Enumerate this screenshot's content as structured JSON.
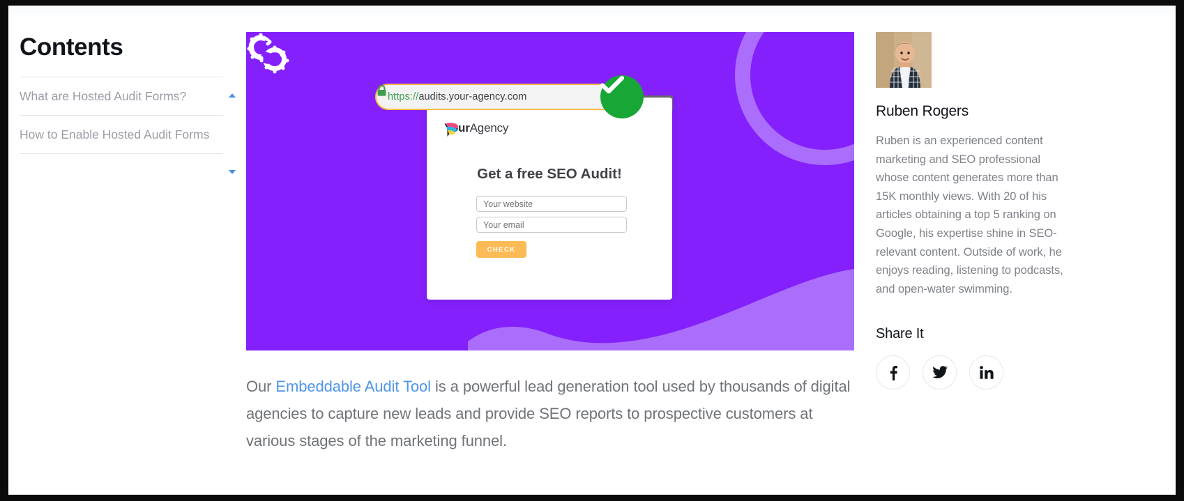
{
  "contents": {
    "title": "Contents",
    "items": [
      {
        "label": "What are Hosted Audit Forms?"
      },
      {
        "label": "How to Enable Hosted Audit Forms"
      }
    ],
    "scroll_up_icon": "caret-up-icon",
    "scroll_down_icon": "caret-down-icon"
  },
  "hero": {
    "background_color": "#8420fb",
    "accent_color": "#ab6efc",
    "browser": {
      "lock_icon": "lock-icon",
      "url_scheme": "https://",
      "url_host": "audits.your-agency.com",
      "url_full": "https://audits.your-agency.com",
      "verified_icon": "check-circle-icon",
      "verified_color": "#18a636"
    },
    "form": {
      "logo_icon": "your-agency-logo-icon",
      "brand_bold": "Your",
      "brand_light": "Agency",
      "heading": "Get a free SEO Audit!",
      "website_placeholder": "Your website",
      "email_placeholder": "Your email",
      "website_value": "",
      "email_value": "",
      "submit_label": "CHECK",
      "submit_color": "#fcbb54"
    },
    "decor_icon": "gears-icon"
  },
  "article": {
    "paragraph_before_link": "Our ",
    "link_text": "Embeddable Audit Tool",
    "link_color": "#4f96e8",
    "paragraph_after_link": " is a powerful lead generation tool used by thousands of digital agencies to capture new leads and provide SEO reports to prospective customers at various stages of the marketing funnel."
  },
  "author": {
    "avatar_icon": "author-avatar",
    "name": "Ruben Rogers",
    "bio": "Ruben is an experienced content marketing and SEO professional whose content generates more than 15K monthly views. With 20 of his articles obtaining a top 5 ranking on Google, his expertise shine in SEO-relevant content. Outside of work, he enjoys reading, listening to podcasts, and open-water swimming."
  },
  "share": {
    "title": "Share It",
    "buttons": [
      {
        "name": "facebook",
        "icon": "facebook-icon"
      },
      {
        "name": "twitter",
        "icon": "twitter-icon"
      },
      {
        "name": "linkedin",
        "icon": "linkedin-icon"
      }
    ]
  }
}
